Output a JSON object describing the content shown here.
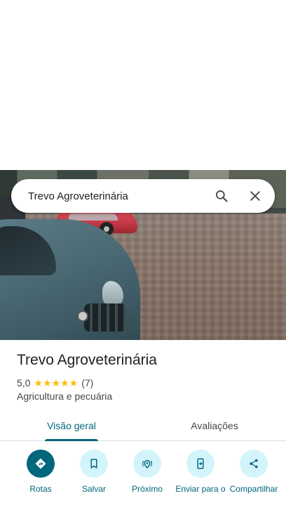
{
  "search": {
    "query": "Trevo Agroveterinária"
  },
  "place": {
    "name": "Trevo Agroveterinária",
    "rating": "5,0",
    "stars": "★★★★★",
    "review_count": "(7)",
    "category": "Agricultura e pecuária"
  },
  "tabs": [
    {
      "label": "Visão geral",
      "active": true
    },
    {
      "label": "Avaliações",
      "active": false
    }
  ],
  "actions": [
    {
      "label": "Rotas",
      "icon": "directions-icon"
    },
    {
      "label": "Salvar",
      "icon": "bookmark-icon"
    },
    {
      "label": "Próximo",
      "icon": "nearby-icon"
    },
    {
      "label": "Enviar para o",
      "icon": "send-to-phone-icon"
    },
    {
      "label": "Compartilhar",
      "icon": "share-icon"
    }
  ],
  "colors": {
    "accent": "#00677d",
    "accent_light": "#d3f4fb",
    "star": "#fbbc04"
  }
}
